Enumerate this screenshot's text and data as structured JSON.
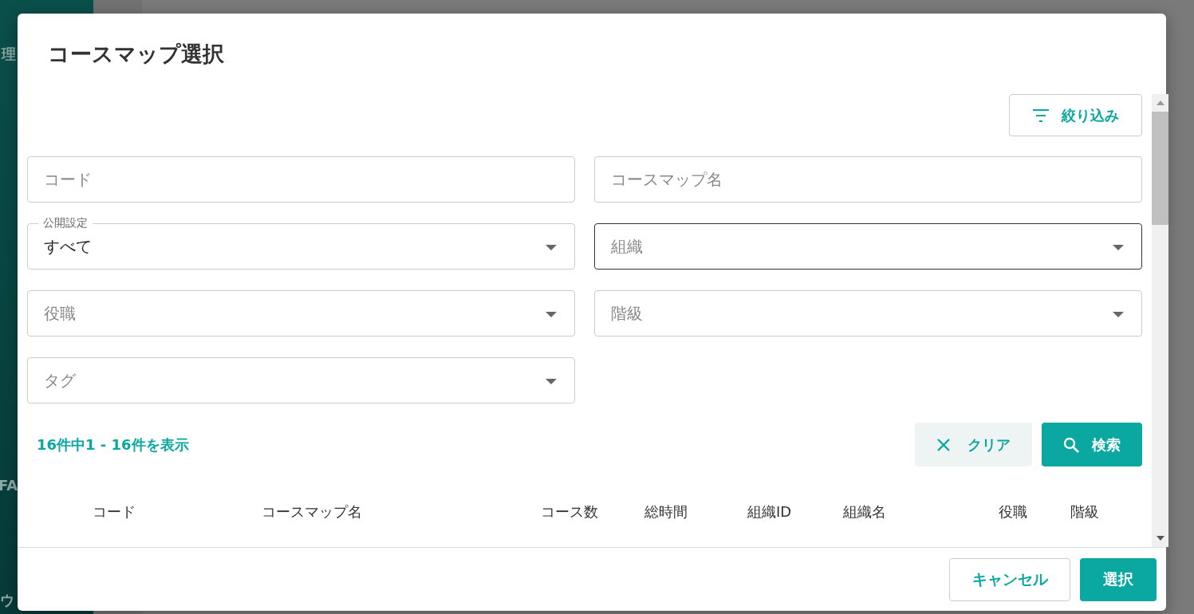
{
  "background": {
    "sidebar_items": [
      "理",
      "FA",
      "ウ"
    ]
  },
  "dialog": {
    "title": "コースマップ選択",
    "filter_button": "絞り込み",
    "fields": [
      {
        "kind": "text",
        "placeholder": "コード",
        "focused": false
      },
      {
        "kind": "text",
        "placeholder": "コースマップ名",
        "focused": false
      },
      {
        "kind": "select",
        "label": "公開設定",
        "value": "すべて",
        "focused": false
      },
      {
        "kind": "select",
        "placeholder": "組織",
        "focused": true
      },
      {
        "kind": "select",
        "placeholder": "役職",
        "focused": false
      },
      {
        "kind": "select",
        "placeholder": "階級",
        "focused": false
      },
      {
        "kind": "select",
        "placeholder": "タグ",
        "focused": false
      }
    ],
    "result_count": "16件中1 - 16件を表示",
    "clear_button": "クリア",
    "search_button": "検索",
    "table": {
      "columns": [
        "コード",
        "コースマップ名",
        "コース数",
        "総時間",
        "組織ID",
        "組織名",
        "役職",
        "階級"
      ]
    },
    "cancel_button": "キャンセル",
    "select_button": "選択"
  }
}
